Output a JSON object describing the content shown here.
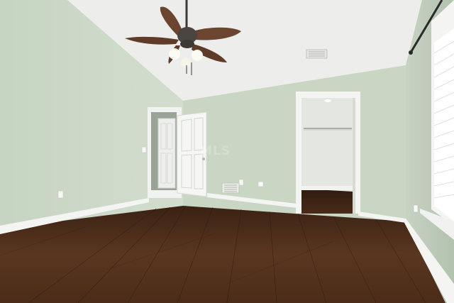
{
  "watermark": {
    "text": "MLS"
  },
  "colors": {
    "wall_left": "#cbd8c7",
    "wall_back": "#c5d4c1",
    "wall_right": "#bccab8",
    "ceiling": "#eeeeec",
    "floor": "#4a2c1a",
    "trim": "#f4f4f2",
    "fan_blade": "#6b4530"
  }
}
